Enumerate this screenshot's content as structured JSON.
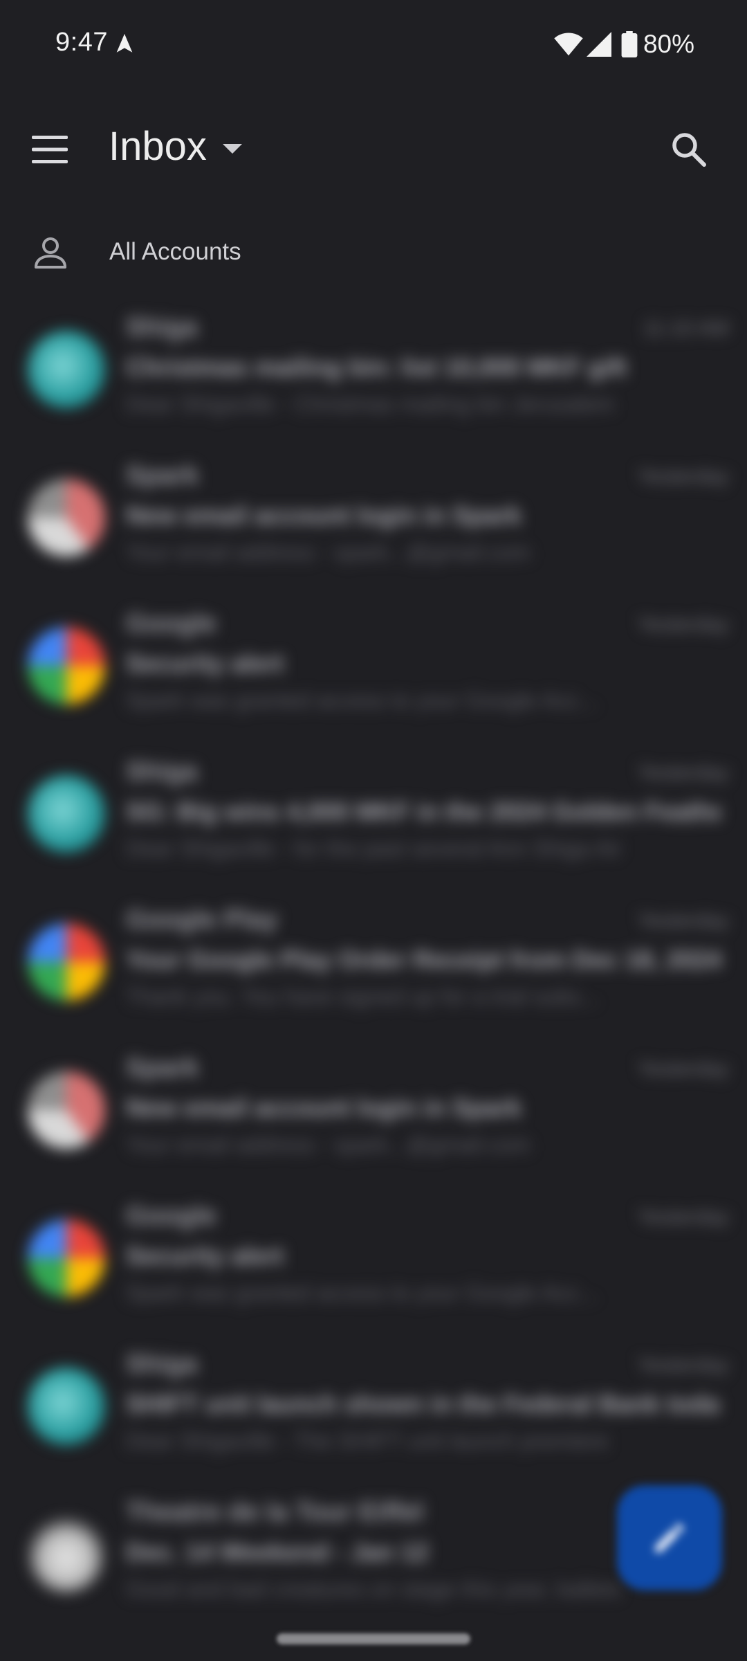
{
  "status_bar": {
    "time": "9:47",
    "battery": "80%",
    "icons": [
      "navigation-arrow-icon",
      "wifi-icon",
      "cell-signal-icon",
      "battery-icon"
    ]
  },
  "app_bar": {
    "title": "Inbox",
    "icons": [
      "menu-icon",
      "dropdown-icon",
      "search-icon"
    ]
  },
  "account_filter": {
    "label": "All Accounts",
    "icon": "person-icon"
  },
  "messages": [
    {
      "sender": "Shiga",
      "date": "11:10 AM",
      "subject": "Christmas mailing bin: list 10,000 MKF gift",
      "snippet": "Dear Shigaville - Christmas mailing bin Jerusalem",
      "avatar": "teal"
    },
    {
      "sender": "Spark",
      "date": "Yesterday",
      "subject": "New email account login in Spark",
      "snippet": "Your email address - spark...@gmail.com",
      "avatar": "red"
    },
    {
      "sender": "Google",
      "date": "Yesterday",
      "subject": "Security alert",
      "snippet": "Spark was granted access to your Google Acc...",
      "avatar": "google"
    },
    {
      "sender": "Shiga",
      "date": "Yesterday",
      "subject": "SG: Big wins 4,000 MKF in the 2024 Golden Feather...",
      "snippet": "Dear Shigaville - for the past several Ann Shiga Air",
      "avatar": "teal"
    },
    {
      "sender": "Google Play",
      "date": "Yesterday",
      "subject": "Your Google Play Order Receipt from Dec 18, 2024",
      "snippet": "Thank you. You have signed up for a trial subs...",
      "avatar": "google"
    },
    {
      "sender": "Spark",
      "date": "Yesterday",
      "subject": "New email account login in Spark",
      "snippet": "Your email address - spark...@gmail.com",
      "avatar": "red"
    },
    {
      "sender": "Google",
      "date": "Yesterday",
      "subject": "Security alert",
      "snippet": "Spark was granted access to your Google Acc...",
      "avatar": "google"
    },
    {
      "sender": "Shiga",
      "date": "Yesterday",
      "subject": "SHIFT unit launch shown in the Federal Bank today",
      "snippet": "Dear Shigaville - The SHIFT unit launch premiere",
      "avatar": "teal"
    },
    {
      "sender": "Theatre de la Tour Eiffel",
      "date": "",
      "subject": "Dec. 14 Weekend - Jan 12",
      "snippet": "Good and bad creatures on stage this year, ballets",
      "avatar": "gray"
    }
  ],
  "fab": {
    "icon": "pencil-icon"
  }
}
